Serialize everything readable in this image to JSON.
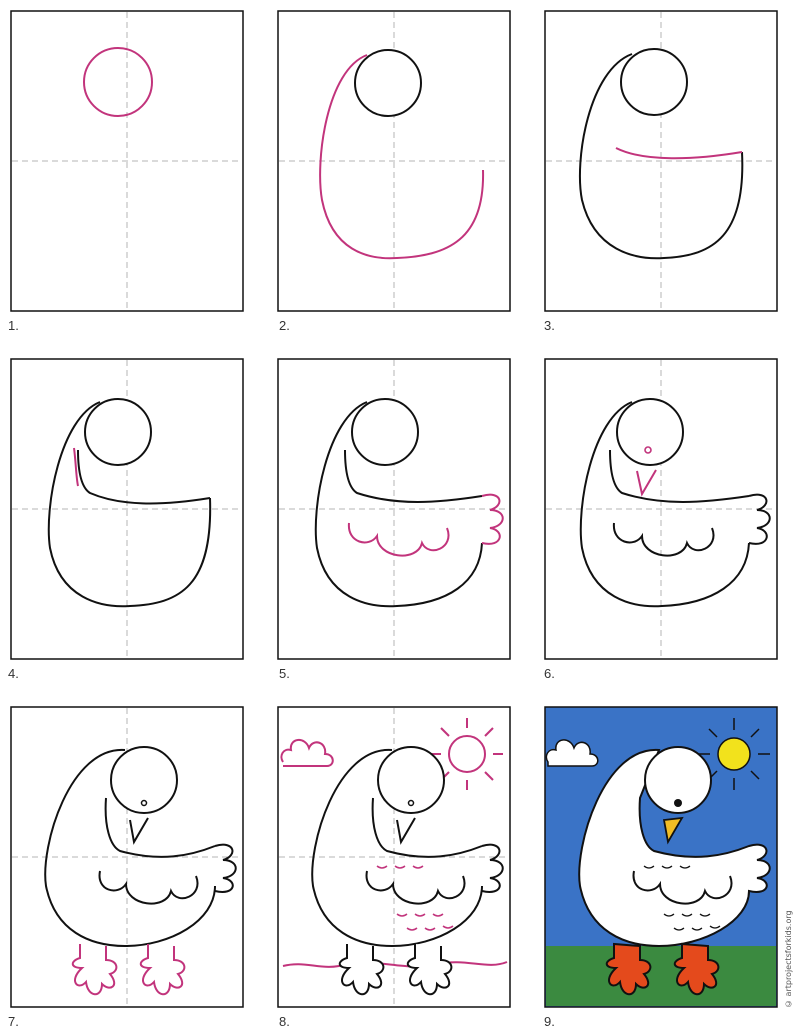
{
  "steps": [
    {
      "label": "1."
    },
    {
      "label": "2."
    },
    {
      "label": "3."
    },
    {
      "label": "4."
    },
    {
      "label": "5."
    },
    {
      "label": "6."
    },
    {
      "label": "7."
    },
    {
      "label": "8."
    },
    {
      "label": "9."
    }
  ],
  "watermark": "© artprojectsforkids.org",
  "colors": {
    "outline": "#111111",
    "new_line": "#c2347c",
    "guide": "#b5b5b5",
    "sky": "#3a73c6",
    "grass": "#3b8a40",
    "sun": "#f2e21c",
    "beak": "#f2bd25",
    "feet": "#e44a1c"
  }
}
